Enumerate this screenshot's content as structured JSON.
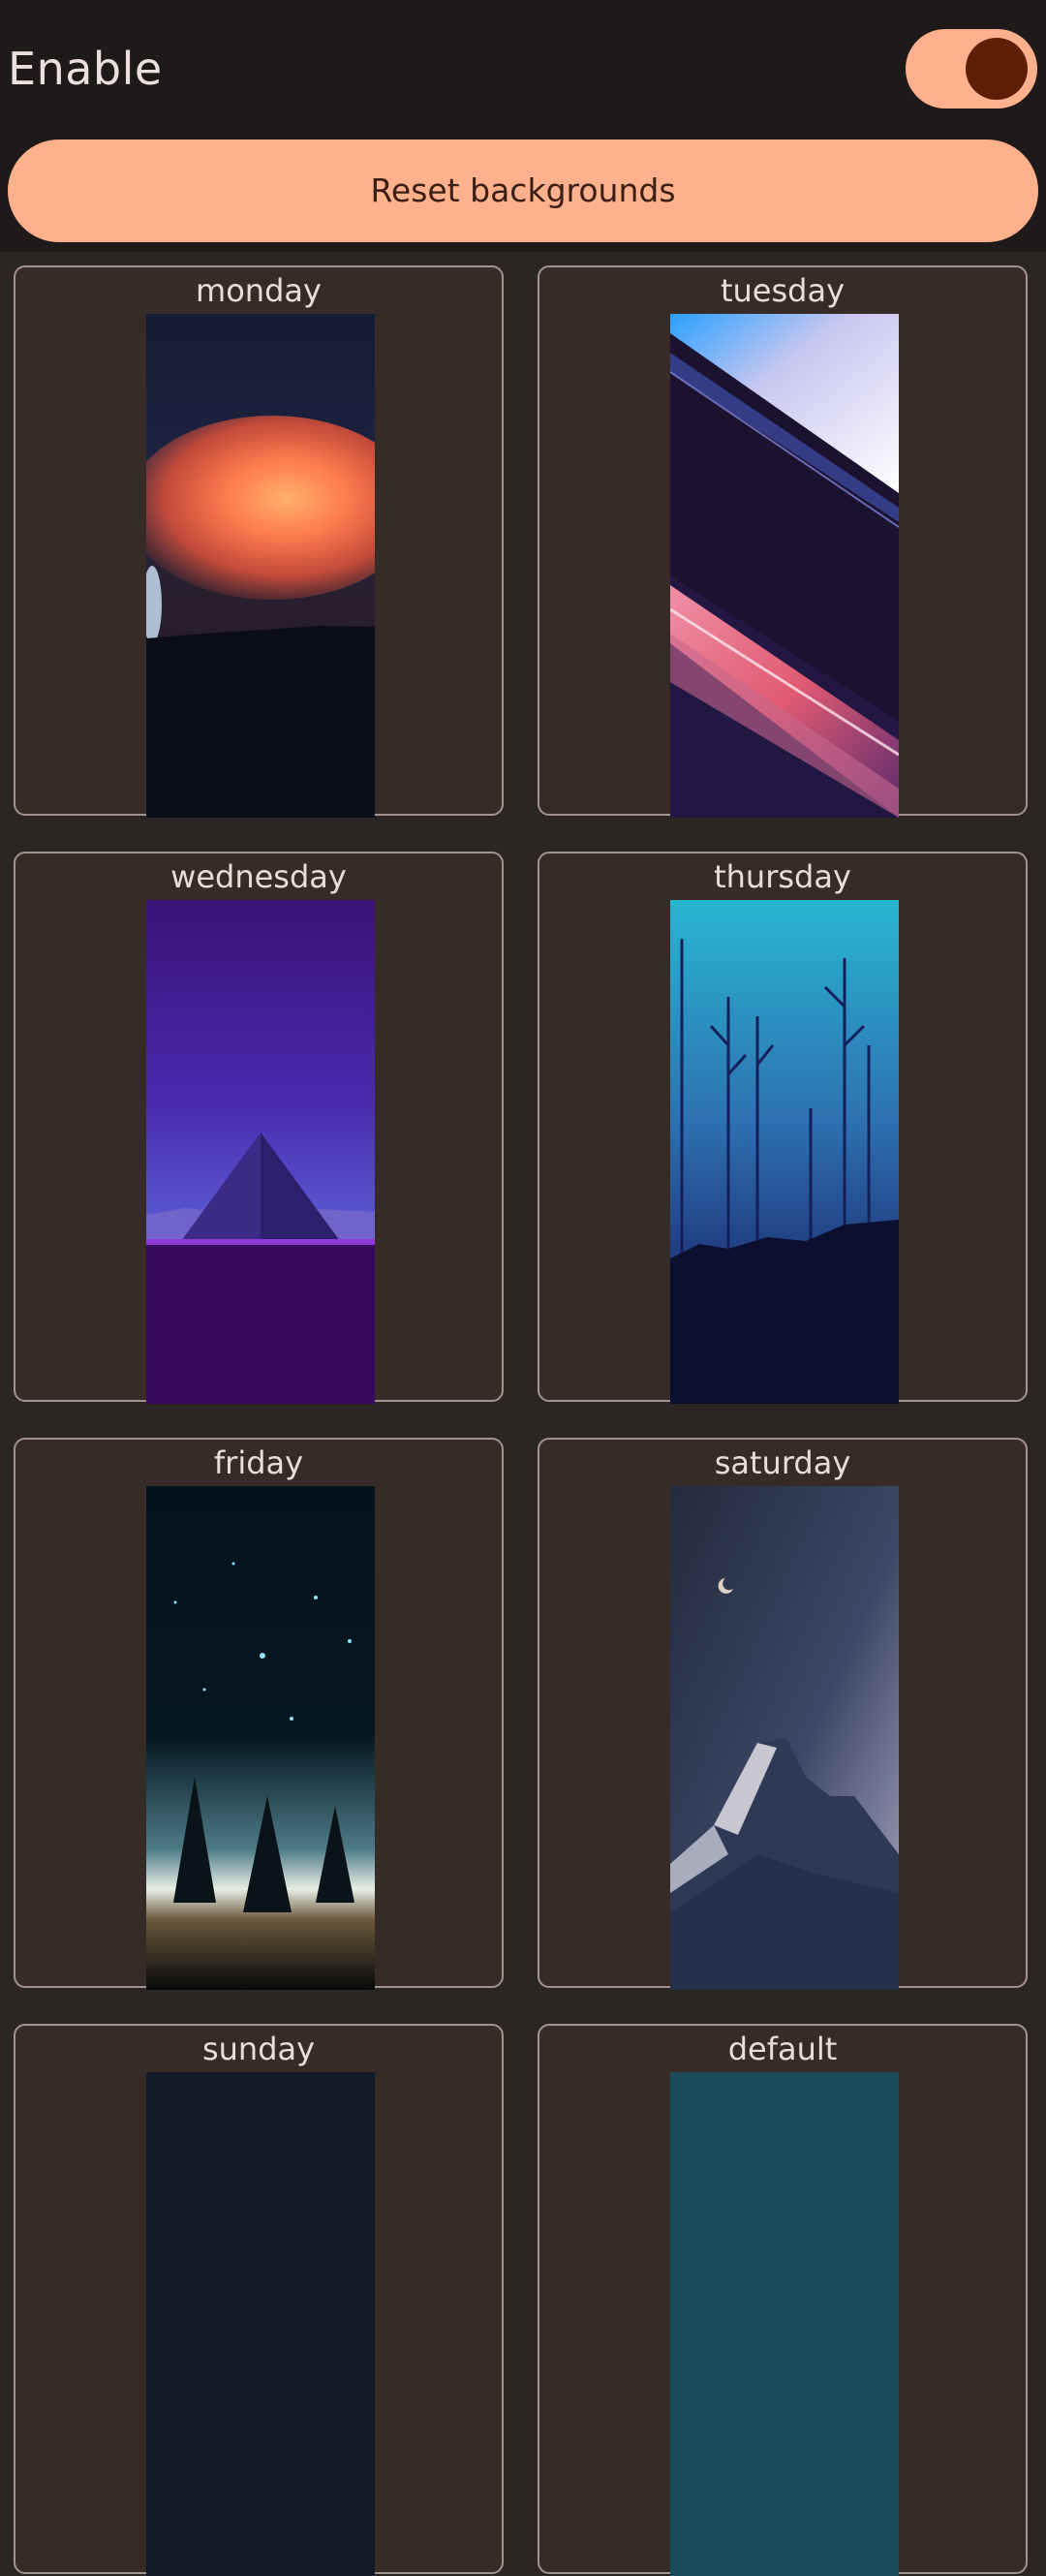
{
  "header": {
    "enable_label": "Enable",
    "toggle_state": "on",
    "reset_label": "Reset backgrounds"
  },
  "cards": [
    {
      "label": "monday",
      "icon": "wallpaper-sunset-thumbnail"
    },
    {
      "label": "tuesday",
      "icon": "wallpaper-light-streaks-thumbnail"
    },
    {
      "label": "wednesday",
      "icon": "wallpaper-pyramid-thumbnail"
    },
    {
      "label": "thursday",
      "icon": "wallpaper-blue-forest-thumbnail"
    },
    {
      "label": "friday",
      "icon": "wallpaper-starry-forest-thumbnail"
    },
    {
      "label": "saturday",
      "icon": "wallpaper-mountain-night-thumbnail"
    },
    {
      "label": "sunday",
      "icon": "wallpaper-thumbnail"
    },
    {
      "label": "default",
      "icon": "wallpaper-thumbnail"
    }
  ],
  "colors": {
    "accent": "#ffb08c",
    "toggle_knob": "#5f1f06",
    "header_bg": "#1e1a19",
    "card_bg": "#362b27",
    "card_border": "#a39390"
  }
}
